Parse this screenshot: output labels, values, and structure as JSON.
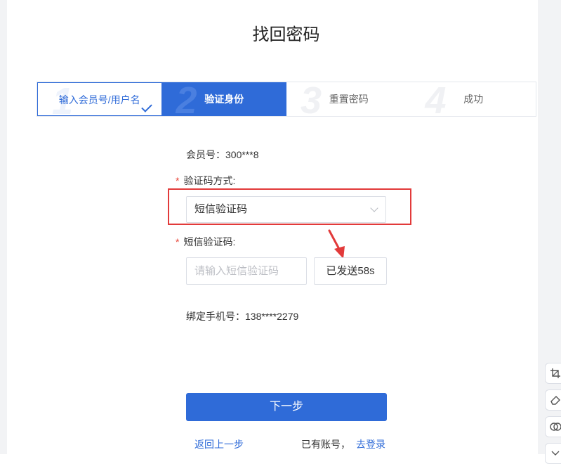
{
  "page": {
    "title": "找回密码"
  },
  "steps": [
    {
      "num": "1",
      "label": "输入会员号/用户名",
      "state": "done"
    },
    {
      "num": "2",
      "label": "验证身份",
      "state": "active"
    },
    {
      "num": "3",
      "label": "重置密码",
      "state": "pending"
    },
    {
      "num": "4",
      "label": "成功",
      "state": "pending"
    }
  ],
  "member": {
    "text": "会员号：300***8"
  },
  "verify_method": {
    "required_mark": "*",
    "label": "验证码方式:",
    "selected": "短信验证码"
  },
  "sms_code": {
    "required_mark": "*",
    "label": "短信验证码:",
    "placeholder": "请输入短信验证码",
    "value": "",
    "send_button": "已发送58s"
  },
  "phone": {
    "text": "绑定手机号：138****2279"
  },
  "actions": {
    "next": "下一步",
    "back": "返回上一步",
    "has_account": "已有账号，",
    "login": "去登录"
  },
  "colors": {
    "primary": "#2f6bd8",
    "annotation": "#e23a3a"
  },
  "side_tools": [
    "crop-icon",
    "eraser-icon",
    "toggle-icon"
  ]
}
